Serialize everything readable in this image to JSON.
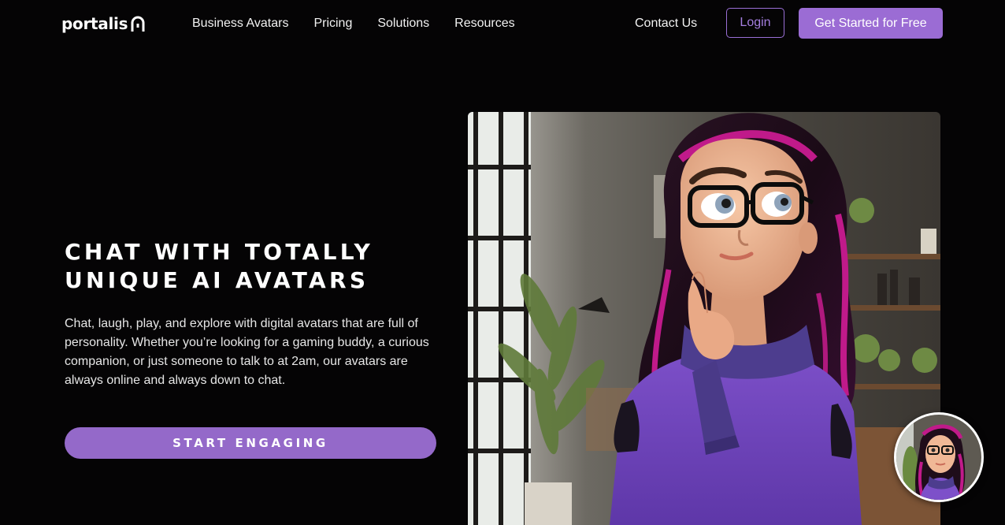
{
  "brand": {
    "name": "portalis",
    "logo_icon": "portal-arch-icon"
  },
  "nav": {
    "links": [
      "Business Avatars",
      "Pricing",
      "Solutions",
      "Resources"
    ],
    "contact_label": "Contact Us",
    "login_label": "Login",
    "get_started_label": "Get Started for Free"
  },
  "hero": {
    "title_line1": "CHAT WITH TOTALLY",
    "title_line2": "UNIQUE AI AVATARS",
    "description": "Chat, laugh, play, and explore with digital avatars that are full of personality. Whether you’re looking for a gaming buddy, a curious companion, or just someone to talk to at 2am, our avatars are always online and always down to chat.",
    "cta_label": "START ENGAGING",
    "image_icon": "avatar-girl-illustration"
  },
  "chat_widget": {
    "icon": "avatar-chat-bubble-icon"
  },
  "colors": {
    "background": "#050405",
    "accent": "#9b6cd4",
    "cta": "#9469c9",
    "login_text": "#a57fe0"
  }
}
